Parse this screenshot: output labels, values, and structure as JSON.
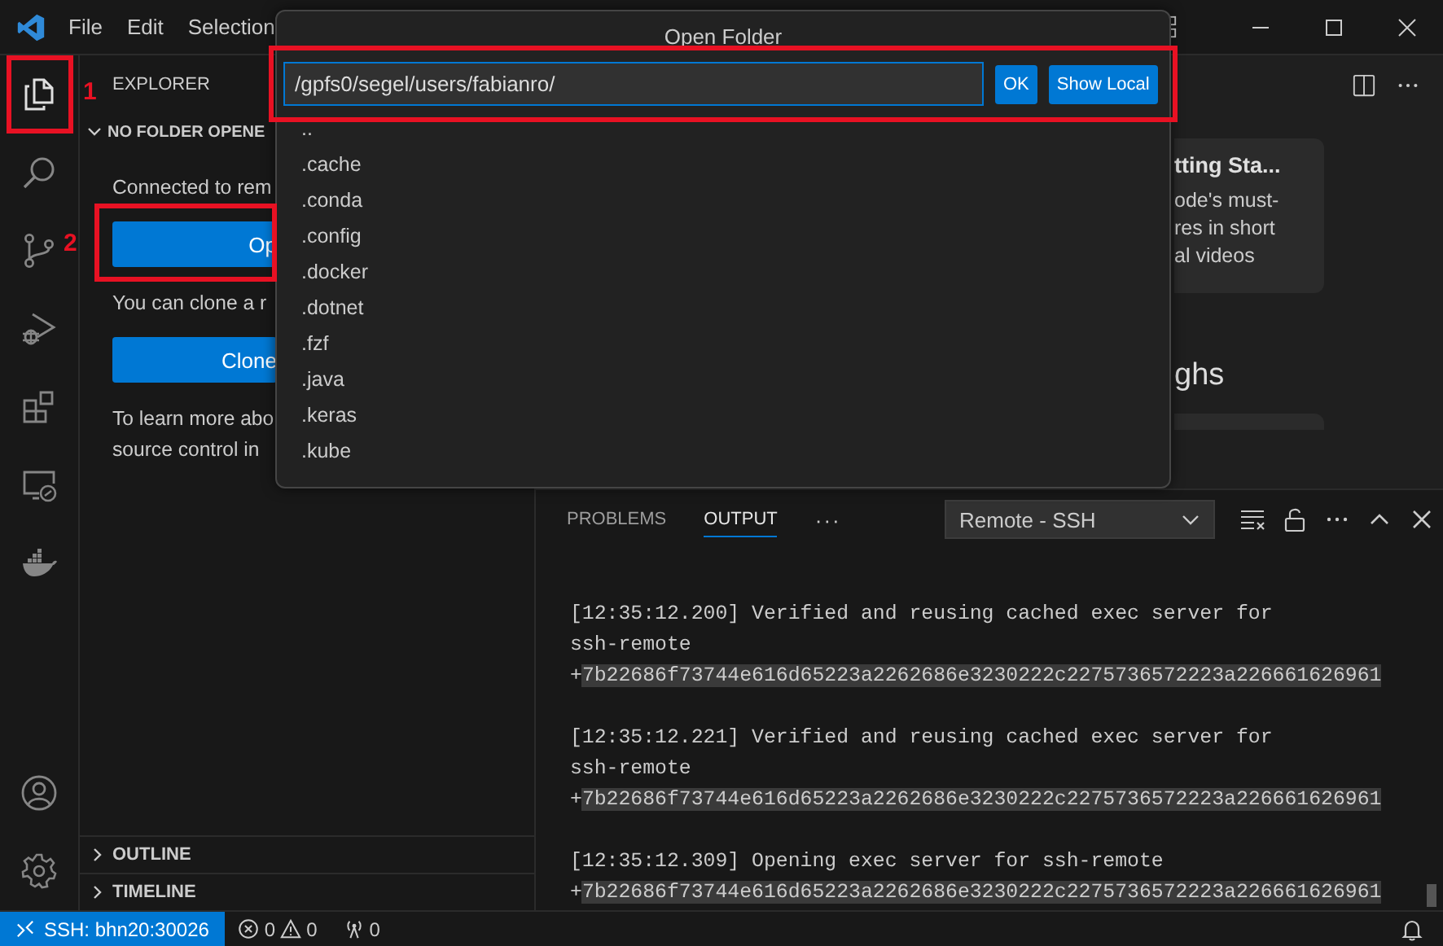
{
  "title_bar": {
    "menu": [
      "File",
      "Edit",
      "Selection"
    ]
  },
  "activity_bar": {
    "items": [
      {
        "kind": "files",
        "selected": true
      },
      {
        "kind": "search",
        "selected": false
      },
      {
        "kind": "scm",
        "selected": false
      },
      {
        "kind": "debug",
        "selected": false
      },
      {
        "kind": "extensions",
        "selected": false
      },
      {
        "kind": "remote",
        "selected": false
      },
      {
        "kind": "docker",
        "selected": false
      }
    ],
    "bottom": [
      {
        "kind": "account"
      },
      {
        "kind": "settings"
      }
    ]
  },
  "sidebar": {
    "title": "EXPLORER",
    "section": "NO FOLDER OPENE",
    "blocks": [
      {
        "kind": "text",
        "text": "Connected to rem"
      },
      {
        "kind": "button",
        "text": "Op"
      },
      {
        "kind": "text",
        "text": "You can clone a r"
      },
      {
        "kind": "button",
        "text": "Clone"
      },
      {
        "kind": "text",
        "text": "To learn more abo"
      },
      {
        "kind": "text",
        "text": "source control in"
      }
    ],
    "collapsed_sections": [
      "OUTLINE",
      "TIMELINE"
    ]
  },
  "dialog": {
    "title": "Open Folder",
    "path": "/gpfs0/segel/users/fabianro/",
    "buttons": [
      "OK",
      "Show Local"
    ],
    "entries": [
      "..",
      ".cache",
      ".conda",
      ".config",
      ".docker",
      ".dotnet",
      ".fzf",
      ".java",
      ".keras",
      ".kube"
    ]
  },
  "welcome": {
    "card_title": "tting Sta...",
    "card_lines": [
      "ode's must-",
      "res in short",
      "al videos"
    ],
    "heading": "ghs"
  },
  "panel": {
    "tabs": [
      {
        "label": "PROBLEMS",
        "selected": false
      },
      {
        "label": "OUTPUT",
        "selected": true
      }
    ],
    "more": "···",
    "channel": "Remote - SSH",
    "output": [
      {
        "lines": [
          "[12:35:12.200] Verified and reusing cached exec server for",
          "ssh-remote"
        ],
        "prefix": "+",
        "hash": "7b22686f73744e616d65223a2262686e3230222c2275736572223a226661626961"
      },
      {
        "lines": [
          "[12:35:12.221] Verified and reusing cached exec server for",
          "ssh-remote"
        ],
        "prefix": "+",
        "hash": "7b22686f73744e616d65223a2262686e3230222c2275736572223a226661626961"
      },
      {
        "lines": [
          "[12:35:12.309] Opening exec server for ssh-remote"
        ],
        "prefix": "+",
        "hash": "7b22686f73744e616d65223a2262686e3230222c2275736572223a226661626961"
      }
    ]
  },
  "status_bar": {
    "remote": "SSH: bhn20:30026",
    "errors": "0",
    "warnings": "0",
    "ports": "0"
  },
  "annotations": [
    {
      "kind": "numbered",
      "label": "1"
    },
    {
      "kind": "numbered",
      "label": "2"
    },
    {
      "kind": "plain"
    }
  ]
}
